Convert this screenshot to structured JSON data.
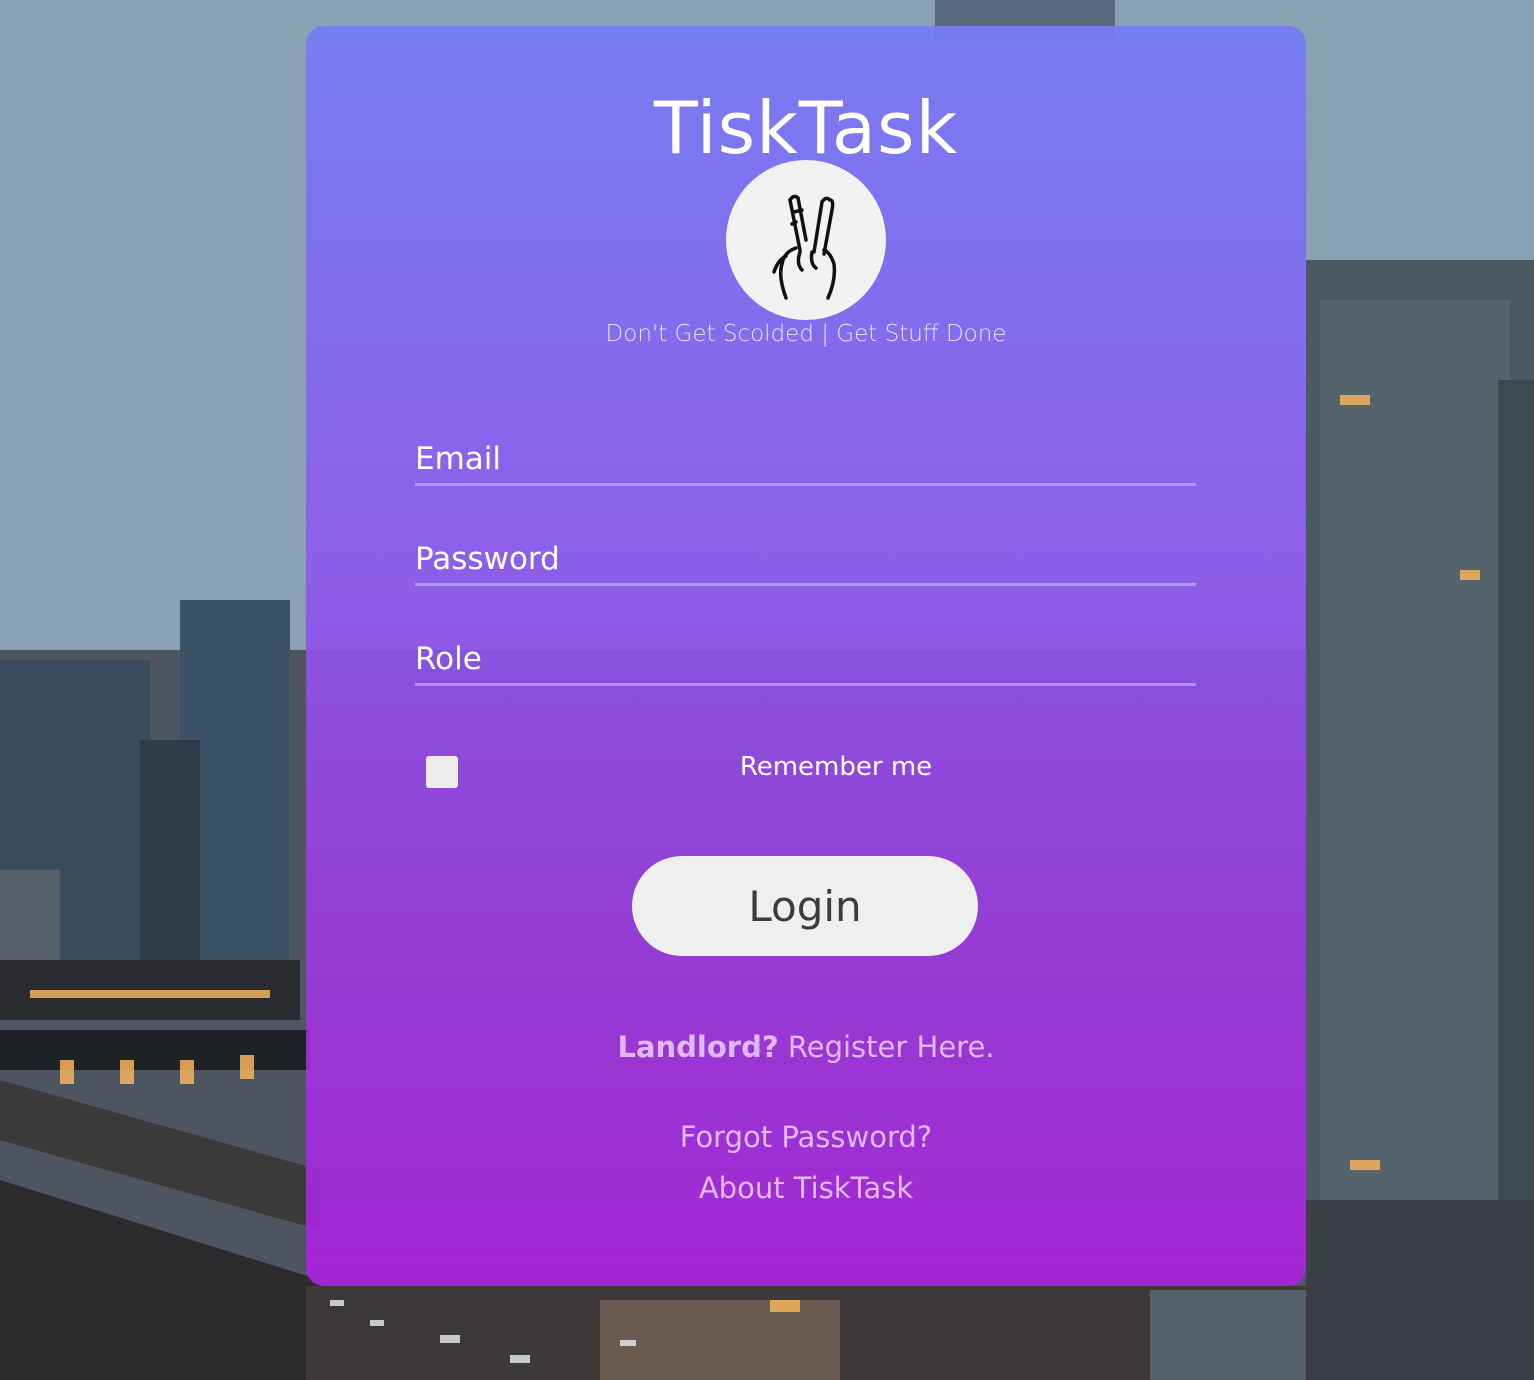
{
  "app": {
    "title": "TiskTask",
    "tagline": "Don't Get Scolded | Get Stuff Done",
    "logo_icon": "crossed-fingers-icon"
  },
  "form": {
    "email_placeholder": "Email",
    "password_placeholder": "Password",
    "role_placeholder": "Role",
    "remember_label": "Remember me",
    "remember_checked": false,
    "login_label": "Login"
  },
  "links": {
    "register_prefix": "Landlord?",
    "register_link": "Register Here.",
    "forgot_password": "Forgot Password?",
    "about": "About TiskTask"
  },
  "colors": {
    "card_gradient_top": "#767af6",
    "card_gradient_bottom": "#aa23de",
    "text": "#ffffff",
    "button_bg": "#efefef",
    "button_text": "#3c3c3c"
  }
}
